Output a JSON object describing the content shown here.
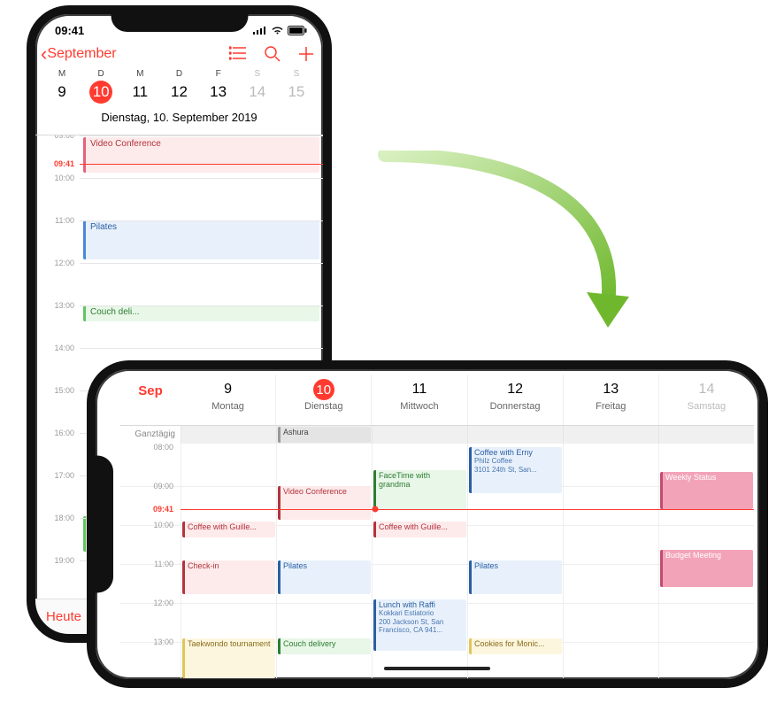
{
  "portrait": {
    "status_time": "09:41",
    "back_label": "September",
    "week_letters": [
      "M",
      "D",
      "M",
      "D",
      "F",
      "S",
      "S"
    ],
    "week_nums": [
      "9",
      "10",
      "11",
      "12",
      "13",
      "14",
      "15"
    ],
    "selected_idx": 1,
    "wknd_idx": [
      5,
      6
    ],
    "day_title": "Dienstag,  10. September 2019",
    "hours": [
      "09:00",
      "10:00",
      "11:00",
      "12:00",
      "13:00",
      "14:00",
      "15:00",
      "16:00",
      "17:00",
      "18:00",
      "19:00"
    ],
    "now_label": "09:41",
    "events": {
      "video": "Video Conference",
      "pilates": "Pilates",
      "couch": "Couch deli..."
    },
    "today_btn": "Heute"
  },
  "landscape": {
    "month_abbr": "Sep",
    "days": [
      {
        "num": "9",
        "dow": "Montag"
      },
      {
        "num": "10",
        "dow": "Dienstag",
        "selected": true
      },
      {
        "num": "11",
        "dow": "Mittwoch"
      },
      {
        "num": "12",
        "dow": "Donnerstag"
      },
      {
        "num": "13",
        "dow": "Freitag"
      },
      {
        "num": "14",
        "dow": "Samstag",
        "wknd": true
      }
    ],
    "allday_label": "Ganztägig",
    "allday_event": "Ashura",
    "hours": [
      "08:00",
      "09:00",
      "10:00",
      "11:00",
      "12:00",
      "13:00"
    ],
    "now_label": "09:41",
    "events": {
      "taekwondo": "Taekwondo tournament",
      "coffee_g1": "Coffee with Guille...",
      "checkin": "Check-in",
      "video": "Video Conference",
      "pilates11": "Pilates",
      "couch": "Couch delivery",
      "facetime": "FaceTime with grandma",
      "coffee_g2": "Coffee with Guille...",
      "lunch_t": "Lunch with Raffi",
      "lunch_s1": "Kokkari Estiatorio",
      "lunch_s2": "200 Jackson St, San Francisco, CA  941...",
      "coffee_e_t": "Coffee with Erny",
      "coffee_e_s1": "Philz Coffee",
      "coffee_e_s2": "3101 24th St, San...",
      "pilates13": "Pilates",
      "cookies": "Cookies for Monic...",
      "weekly": "Weekly Status",
      "budget": "Budget Meeting"
    }
  }
}
